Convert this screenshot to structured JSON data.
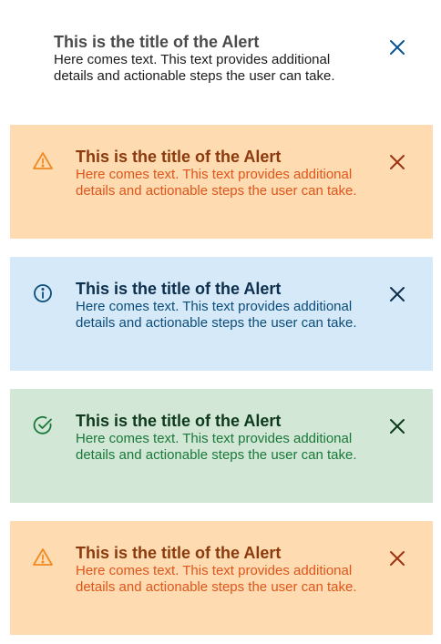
{
  "alerts": [
    {
      "variant": "plain",
      "title": "This is the title of the Alert",
      "body": "Here comes text. This text provides additional details and actionable steps the user can take.",
      "icon": "none",
      "close_icon": "close-icon",
      "colors": {
        "title": "#4a4a4a",
        "body": "#1b1b1b",
        "close": "#0b5394"
      }
    },
    {
      "variant": "warning",
      "title": "This is the title of the Alert",
      "body": "Here comes text. This text provides additional details and actionable steps the user can take.",
      "icon": "warning-icon",
      "close_icon": "close-icon",
      "colors": {
        "background": "#fedbb0",
        "icon": "#f08a24",
        "close": "#9a3412"
      }
    },
    {
      "variant": "info",
      "title": "This is the title of the Alert",
      "body": "Here comes text. This text provides additional details and actionable steps the user can take.",
      "icon": "info-icon",
      "close_icon": "close-icon",
      "colors": {
        "background": "#d6e9f8",
        "icon": "#0b4d7a",
        "close": "#0c2f4d"
      }
    },
    {
      "variant": "success",
      "title": "This is the title of the Alert",
      "body": "Here comes text. This text provides additional details and actionable steps the user can take.",
      "icon": "check-circle-icon",
      "close_icon": "close-icon",
      "colors": {
        "background": "#d3e7d6",
        "icon": "#19783a",
        "close": "#0d3a1d"
      }
    },
    {
      "variant": "warning",
      "title": "This is the title of the Alert",
      "body": "Here comes text. This text provides additional details and actionable steps the user can take.",
      "icon": "warning-icon",
      "close_icon": "close-icon",
      "colors": {
        "background": "#fedbb0",
        "icon": "#f08a24",
        "close": "#9a3412"
      }
    }
  ]
}
